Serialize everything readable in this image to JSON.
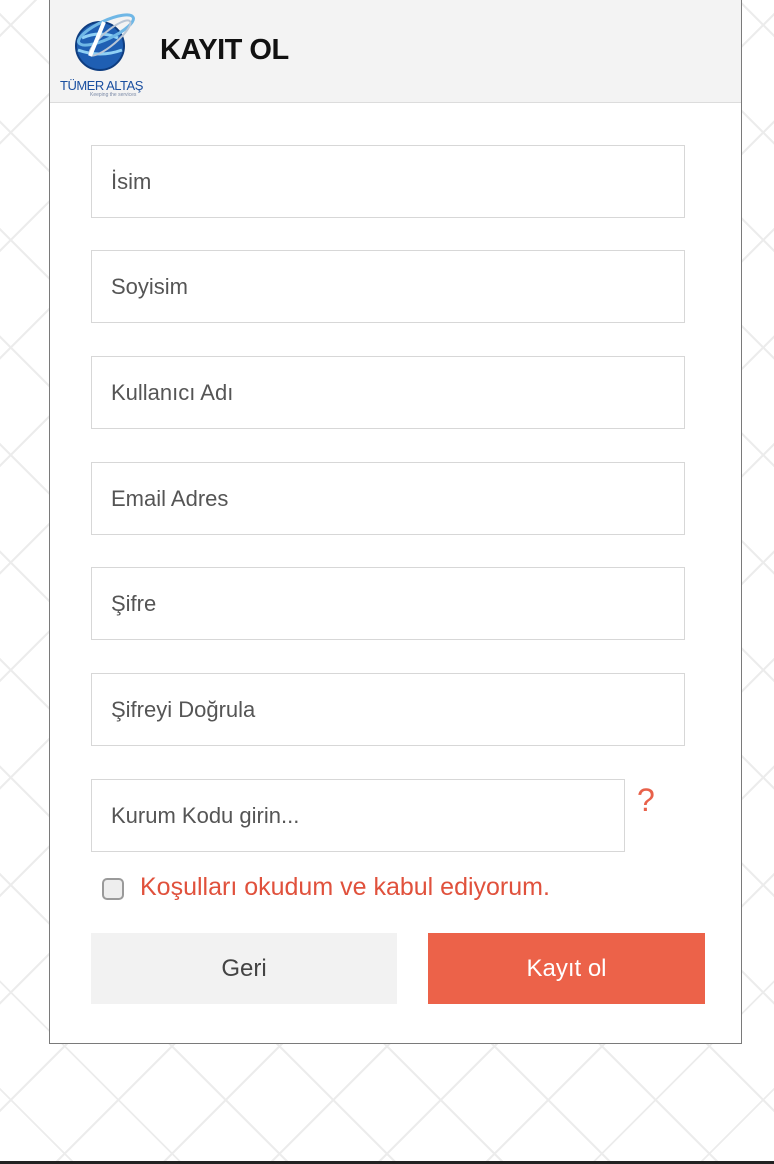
{
  "header": {
    "logo_text": "TÜMER ALTAŞ",
    "logo_tagline": "Keeping the services",
    "title": "KAYIT OL"
  },
  "form": {
    "first_name_placeholder": "İsim",
    "last_name_placeholder": "Soyisim",
    "username_placeholder": "Kullanıcı Adı",
    "email_placeholder": "Email Adres",
    "password_placeholder": "Şifre",
    "password_confirm_placeholder": "Şifreyi Doğrula",
    "org_code_placeholder": "Kurum Kodu girin...",
    "help_symbol": "?",
    "terms_label": "Koşulları okudum ve kabul ediyorum.",
    "terms_checked": false
  },
  "buttons": {
    "back_label": "Geri",
    "submit_label": "Kayıt ol"
  },
  "colors": {
    "accent": "#ec6249",
    "terms_text": "#e0513c",
    "header_bg": "#f3f3f3"
  }
}
